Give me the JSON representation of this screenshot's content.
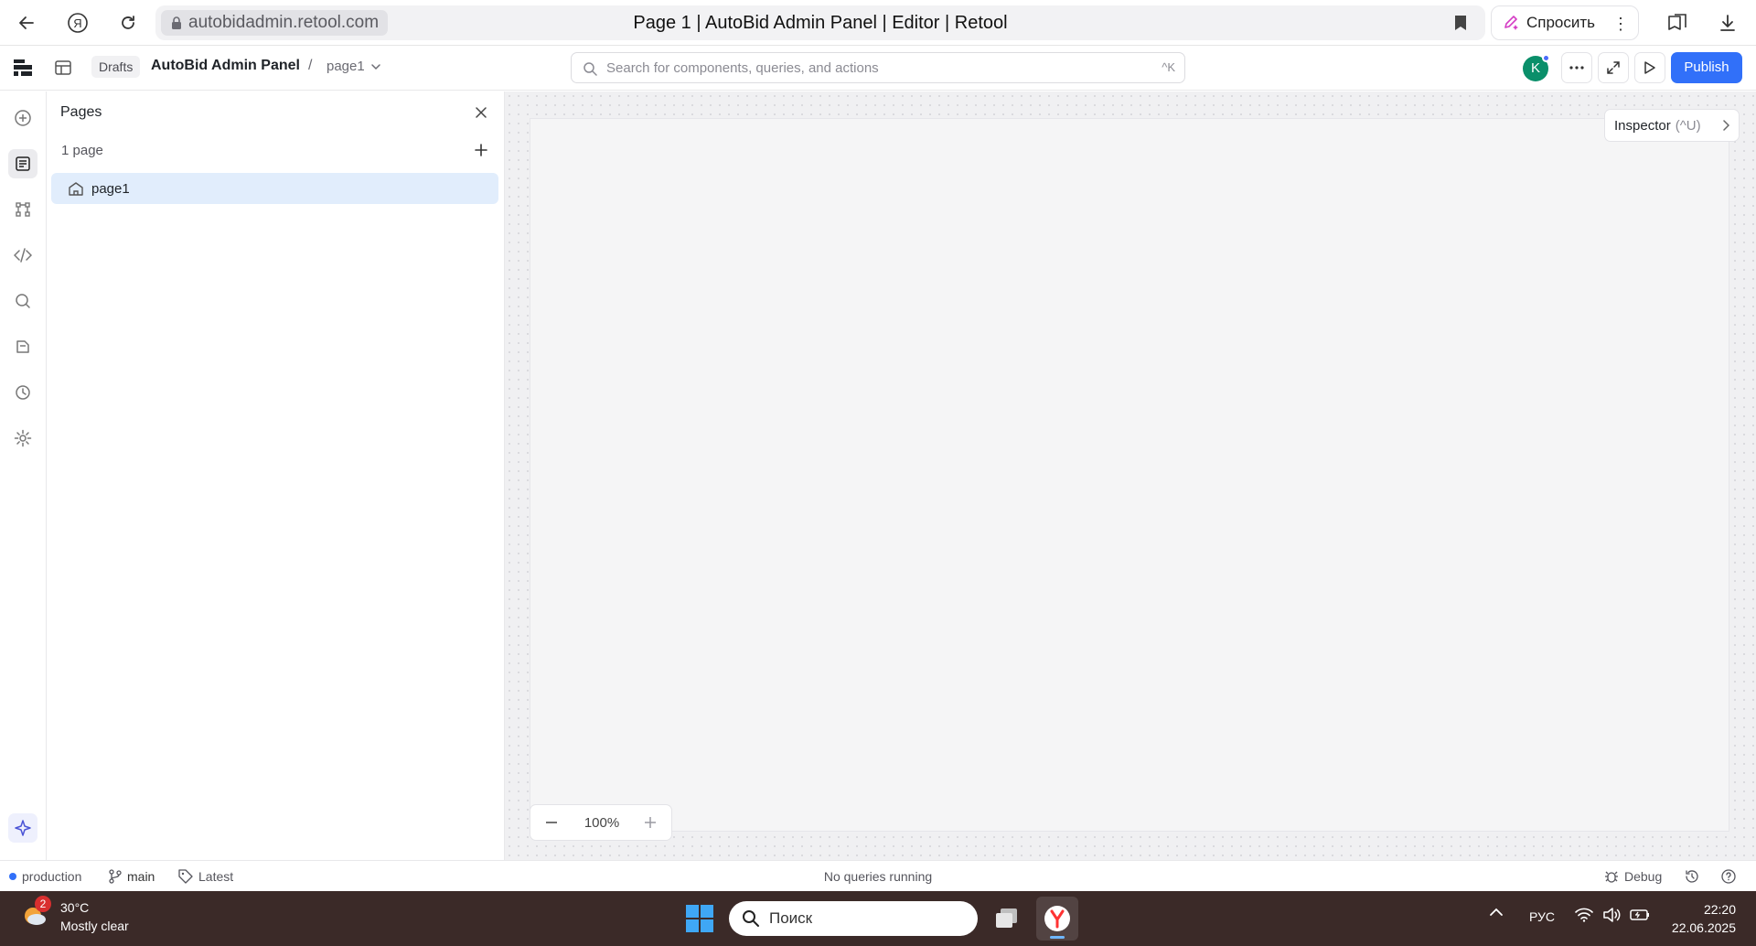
{
  "browser": {
    "url": "autobidadmin.retool.com",
    "tab_title": "Page 1 | AutoBid Admin Panel | Editor | Retool",
    "ask_label": "Спросить"
  },
  "header": {
    "drafts_label": "Drafts",
    "app_name": "AutoBid Admin Panel",
    "separator": "/",
    "current_page": "page1",
    "search_placeholder": "Search for components, queries, and actions",
    "search_shortcut": "^K",
    "avatar_initial": "K",
    "publish_label": "Publish"
  },
  "rail": {
    "icons": [
      "add-component-icon",
      "pages-icon",
      "component-tree-icon",
      "code-icon",
      "search-icon",
      "state-icon",
      "history-icon",
      "settings-icon"
    ],
    "ai_icon": "sparkle-icon"
  },
  "pages_panel": {
    "title": "Pages",
    "count_label": "1 page",
    "pages": [
      {
        "label": "page1",
        "is_home": true,
        "selected": true
      }
    ]
  },
  "canvas": {
    "inspector_label": "Inspector",
    "inspector_shortcut": "(^U)",
    "zoom_value": "100%"
  },
  "status_bar": {
    "environment": "production",
    "branch": "main",
    "tag": "Latest",
    "query_status": "No queries running",
    "debug_label": "Debug"
  },
  "taskbar": {
    "weather_temp": "30°C",
    "weather_desc": "Mostly clear",
    "weather_badge": "2",
    "search_placeholder": "Поиск",
    "language": "РУС",
    "time": "22:20",
    "date": "22.06.2025"
  },
  "colors": {
    "accent": "#3170f9",
    "selected_row": "#e1edfc",
    "avatar": "#0a8f6a",
    "taskbar": "#3b2a28"
  }
}
